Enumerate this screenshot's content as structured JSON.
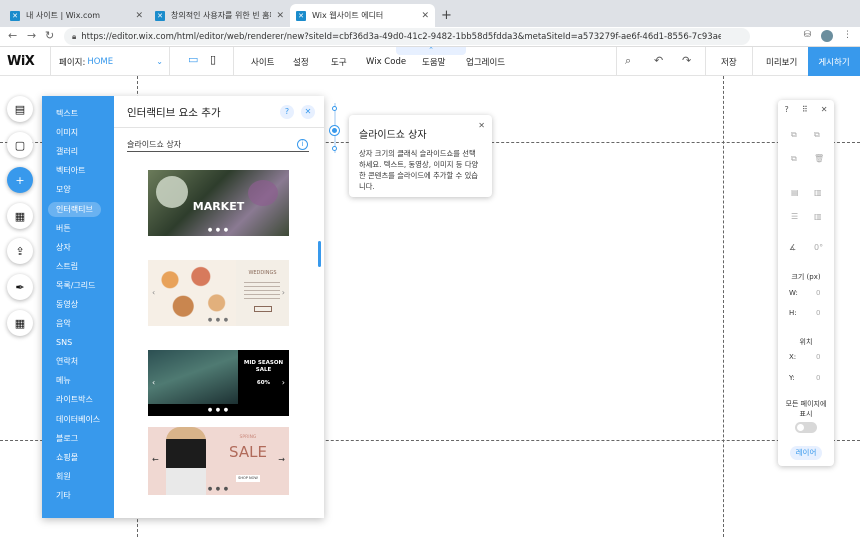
{
  "browser": {
    "tabs": [
      {
        "label": "내 사이트 | Wix.com"
      },
      {
        "label": "창의적인 사용자를 위한 빈 홈페이지"
      },
      {
        "label": "Wix 웹사이트 에디터"
      }
    ],
    "url": "https://editor.wix.com/html/editor/web/renderer/new?siteId=cbf36d3a-49d0-41c2-9482-1bb58d5fdda3&metaSiteId=a573279f-ae6f-46d1-8556-7c93ae9b2c84&edito..."
  },
  "topbar": {
    "logo": "WiX",
    "page_label": "페이지:",
    "page_value": "HOME",
    "menu": [
      "사이트",
      "설정",
      "도구",
      "Wix Code",
      "도움말",
      "업그레이드"
    ],
    "save": "저장",
    "preview": "미리보기",
    "publish": "게시하기"
  },
  "add_panel": {
    "title": "인터랙티브 요소 추가",
    "categories": [
      "텍스트",
      "이미지",
      "갤러리",
      "벡터아트",
      "모양",
      "인터랙티브",
      "버튼",
      "상자",
      "스트립",
      "목록/그리드",
      "동영상",
      "음악",
      "SNS",
      "연락처",
      "메뉴",
      "라이트박스",
      "데이터베이스",
      "블로그",
      "쇼핑몰",
      "회원",
      "기타"
    ],
    "selected_index": 5,
    "section_heading": "슬라이드쇼 상자",
    "thumbnails": [
      {
        "main_text": "MARKET"
      },
      {
        "main_text": "WEDDINGS"
      },
      {
        "main_text": "MID SEASON SALE",
        "sub_text": "60%"
      },
      {
        "main_text": "SALE",
        "sub_text": "SPRING",
        "button": "SHOP NOW"
      }
    ]
  },
  "tooltip": {
    "title": "슬라이드쇼 상자",
    "body": "상자 크기의 클래식 슬라이드쇼를 선택하세요. 텍스트, 동영상, 이미지 등 다양한 콘텐츠를 슬라이드에 추가할 수 있습니다."
  },
  "inspector": {
    "help": "?",
    "angle": "0°",
    "size_label": "크기 (px)",
    "w_label": "W:",
    "w_value": "0",
    "h_label": "H:",
    "h_value": "0",
    "pos_label": "위치",
    "x_label": "X:",
    "x_value": "0",
    "y_label": "Y:",
    "y_value": "0",
    "all_pages_label": "모든 페이지에 표시",
    "layers": "레이어"
  },
  "colors": {
    "accent": "#3899ec"
  }
}
